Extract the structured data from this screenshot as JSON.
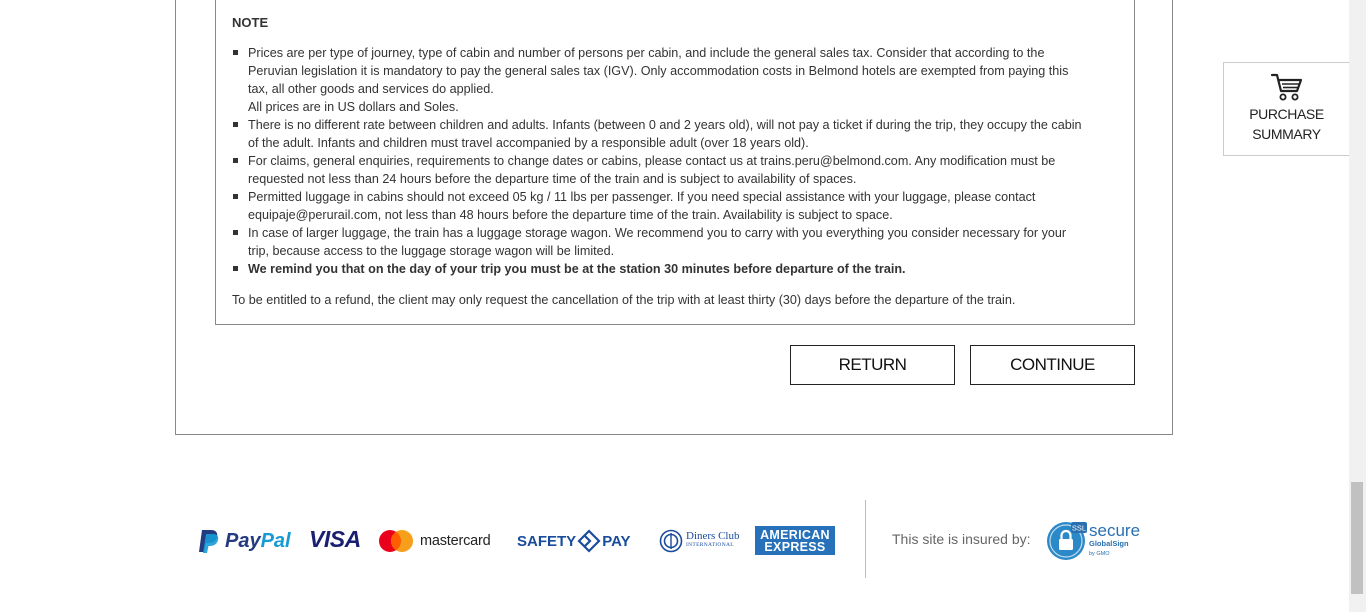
{
  "note": {
    "title": "NOTE",
    "items": [
      {
        "lines": [
          "Prices are per type of journey, type of cabin and number of persons per cabin, and include the general sales tax. Consider that according to the",
          "Peruvian legislation it is mandatory to pay the general sales tax (IGV). Only accommodation costs in Belmond hotels are exempted from paying this",
          "tax, all other goods and services do applied.",
          "All prices are in US dollars and Soles."
        ]
      },
      {
        "lines": [
          "There is no different rate between children and adults. Infants (between 0 and 2 years old), will not pay a ticket if during the trip, they occupy the cabin",
          "of the adult. Infants and children must travel accompanied by a responsible adult (over 18 years old)."
        ]
      },
      {
        "lines": [
          "For claims, general enquiries, requirements to change dates or cabins, please contact us at trains.peru@belmond.com. Any modification must be",
          "requested not less than 24 hours before the departure time of the train and is subject to availability of spaces."
        ]
      },
      {
        "lines": [
          "Permitted luggage in cabins should not exceed 05 kg / 11 lbs per passenger. If you need special assistance with your luggage, please contact",
          "equipaje@perurail.com, not less than 48 hours before the departure time of the train. Availability is subject to space."
        ]
      },
      {
        "lines": [
          "In case of larger luggage, the train has a luggage storage wagon. We recommend you to carry with you everything you consider necessary for your",
          "trip, because access to the luggage storage wagon will be limited."
        ]
      },
      {
        "lines": [
          "We remind you that on the day of your trip you must be at the station 30 minutes before departure of the train."
        ]
      }
    ],
    "refund": "To be entitled to a refund, the client may only request the cancellation of the trip with at least thirty (30) days before the departure of the train."
  },
  "buttons": {
    "return_label": "RETURN",
    "continue_label": "CONTINUE"
  },
  "summary": {
    "line1": "PURCHASE",
    "line2": "SUMMARY",
    "icon": "cart-icon"
  },
  "footer": {
    "payments": {
      "paypal_pay": "Pay",
      "paypal_pal": "Pal",
      "visa": "VISA",
      "mastercard": "mastercard",
      "safetypay_left": "SAFETY",
      "safetypay_right": "PAY",
      "diners_main": "Diners Club",
      "diners_sub": "INTERNATIONAL",
      "amex_line1": "AMERICAN",
      "amex_line2": "EXPRESS"
    },
    "insured_text": "This site is insured by:",
    "ssl": {
      "badge": "SSL",
      "secure": "secure",
      "globalsign": "GlobalSign",
      "gmo": "by GMO"
    }
  },
  "colors": {
    "paypal_dark": "#253b80",
    "paypal_light": "#179bd7",
    "visa": "#1a1f71",
    "amex": "#2671b9",
    "mc_red": "#eb001b",
    "mc_yellow": "#f79e1b"
  }
}
